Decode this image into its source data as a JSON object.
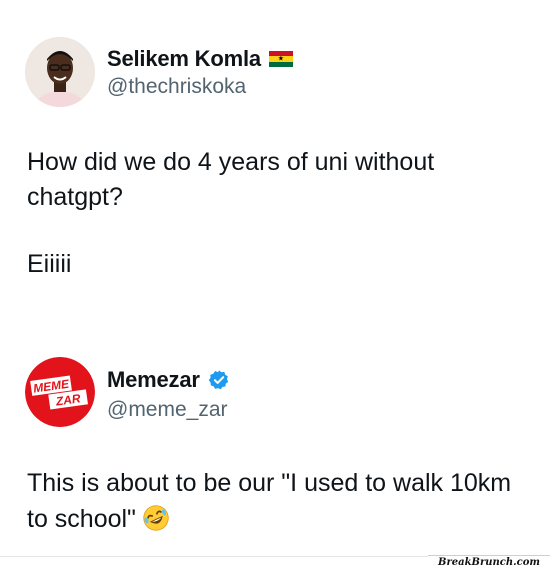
{
  "tweet1": {
    "display_name": "Selikem Komla",
    "flag": "ghana-flag-icon",
    "handle": "@thechriskoka",
    "text_line1": "How did we do 4 years of uni without",
    "text_line2": "chatgpt?",
    "text_line3": "Eiiiii"
  },
  "tweet2": {
    "display_name": "Memezar",
    "verified_icon": "verified-badge-icon",
    "handle": "@meme_zar",
    "avatar_line1": "MEME",
    "avatar_line2": "ZAR",
    "text_line1": "This is about to be our \"I used to walk 10km",
    "text_line2": "to school\"",
    "emoji": "rolling-laughing-emoji"
  },
  "watermark": "BreakBrunch.com",
  "colors": {
    "handle_gray": "#536471",
    "text": "#0f1419",
    "memezar_red": "#e3131b",
    "verified_blue": "#1d9bf0"
  }
}
